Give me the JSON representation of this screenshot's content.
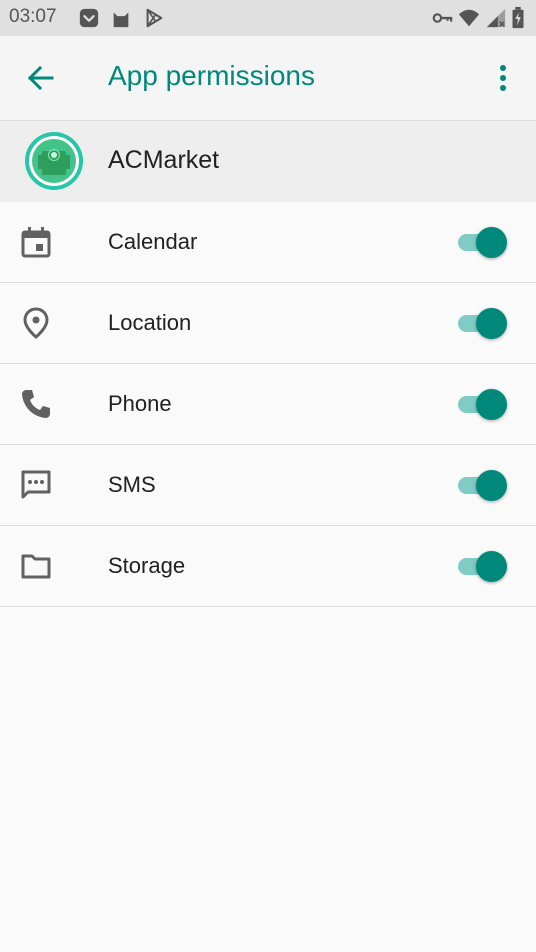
{
  "status_bar": {
    "time": "03:07",
    "left_icons": [
      "pocket-icon",
      "cat-icon",
      "play-store-icon"
    ],
    "right_icons": [
      "vpn-key-icon",
      "wifi-icon",
      "signal-icon",
      "battery-icon"
    ]
  },
  "toolbar": {
    "title": "App permissions",
    "back_icon": "arrow-back-icon",
    "overflow_icon": "more-vert-icon",
    "accent_color": "#00897b"
  },
  "app": {
    "name": "ACMarket",
    "icon": "acmarket-app-icon"
  },
  "permissions": [
    {
      "label": "Calendar",
      "icon": "calendar-icon",
      "enabled": true
    },
    {
      "label": "Location",
      "icon": "location-icon",
      "enabled": true
    },
    {
      "label": "Phone",
      "icon": "phone-icon",
      "enabled": true
    },
    {
      "label": "SMS",
      "icon": "sms-icon",
      "enabled": true
    },
    {
      "label": "Storage",
      "icon": "folder-icon",
      "enabled": true
    }
  ],
  "colors": {
    "switch_thumb": "#00897b",
    "switch_track": "#80cbc4"
  }
}
